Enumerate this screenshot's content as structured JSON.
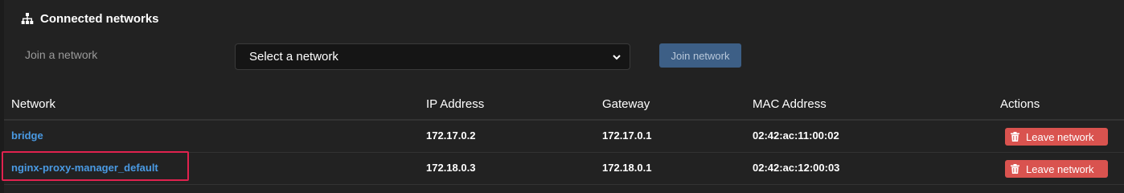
{
  "header": {
    "title": "Connected networks",
    "icon": "sitemap-icon"
  },
  "join": {
    "label": "Join a network",
    "select_value": "Select a network",
    "button_label": "Join network"
  },
  "table": {
    "columns": [
      "Network",
      "IP Address",
      "Gateway",
      "MAC Address",
      "Actions"
    ],
    "rows": [
      {
        "network": "bridge",
        "ip": "172.17.0.2",
        "gateway": "172.17.0.1",
        "mac": "02:42:ac:11:00:02",
        "action": "Leave network"
      },
      {
        "network": "nginx-proxy-manager_default",
        "ip": "172.18.0.3",
        "gateway": "172.18.0.1",
        "mac": "02:42:ac:12:00:03",
        "action": "Leave network"
      }
    ]
  },
  "colors": {
    "link": "#4a9ae3",
    "danger": "#d9534f",
    "highlight": "#e0224e",
    "join_button": "#3d5f86"
  }
}
